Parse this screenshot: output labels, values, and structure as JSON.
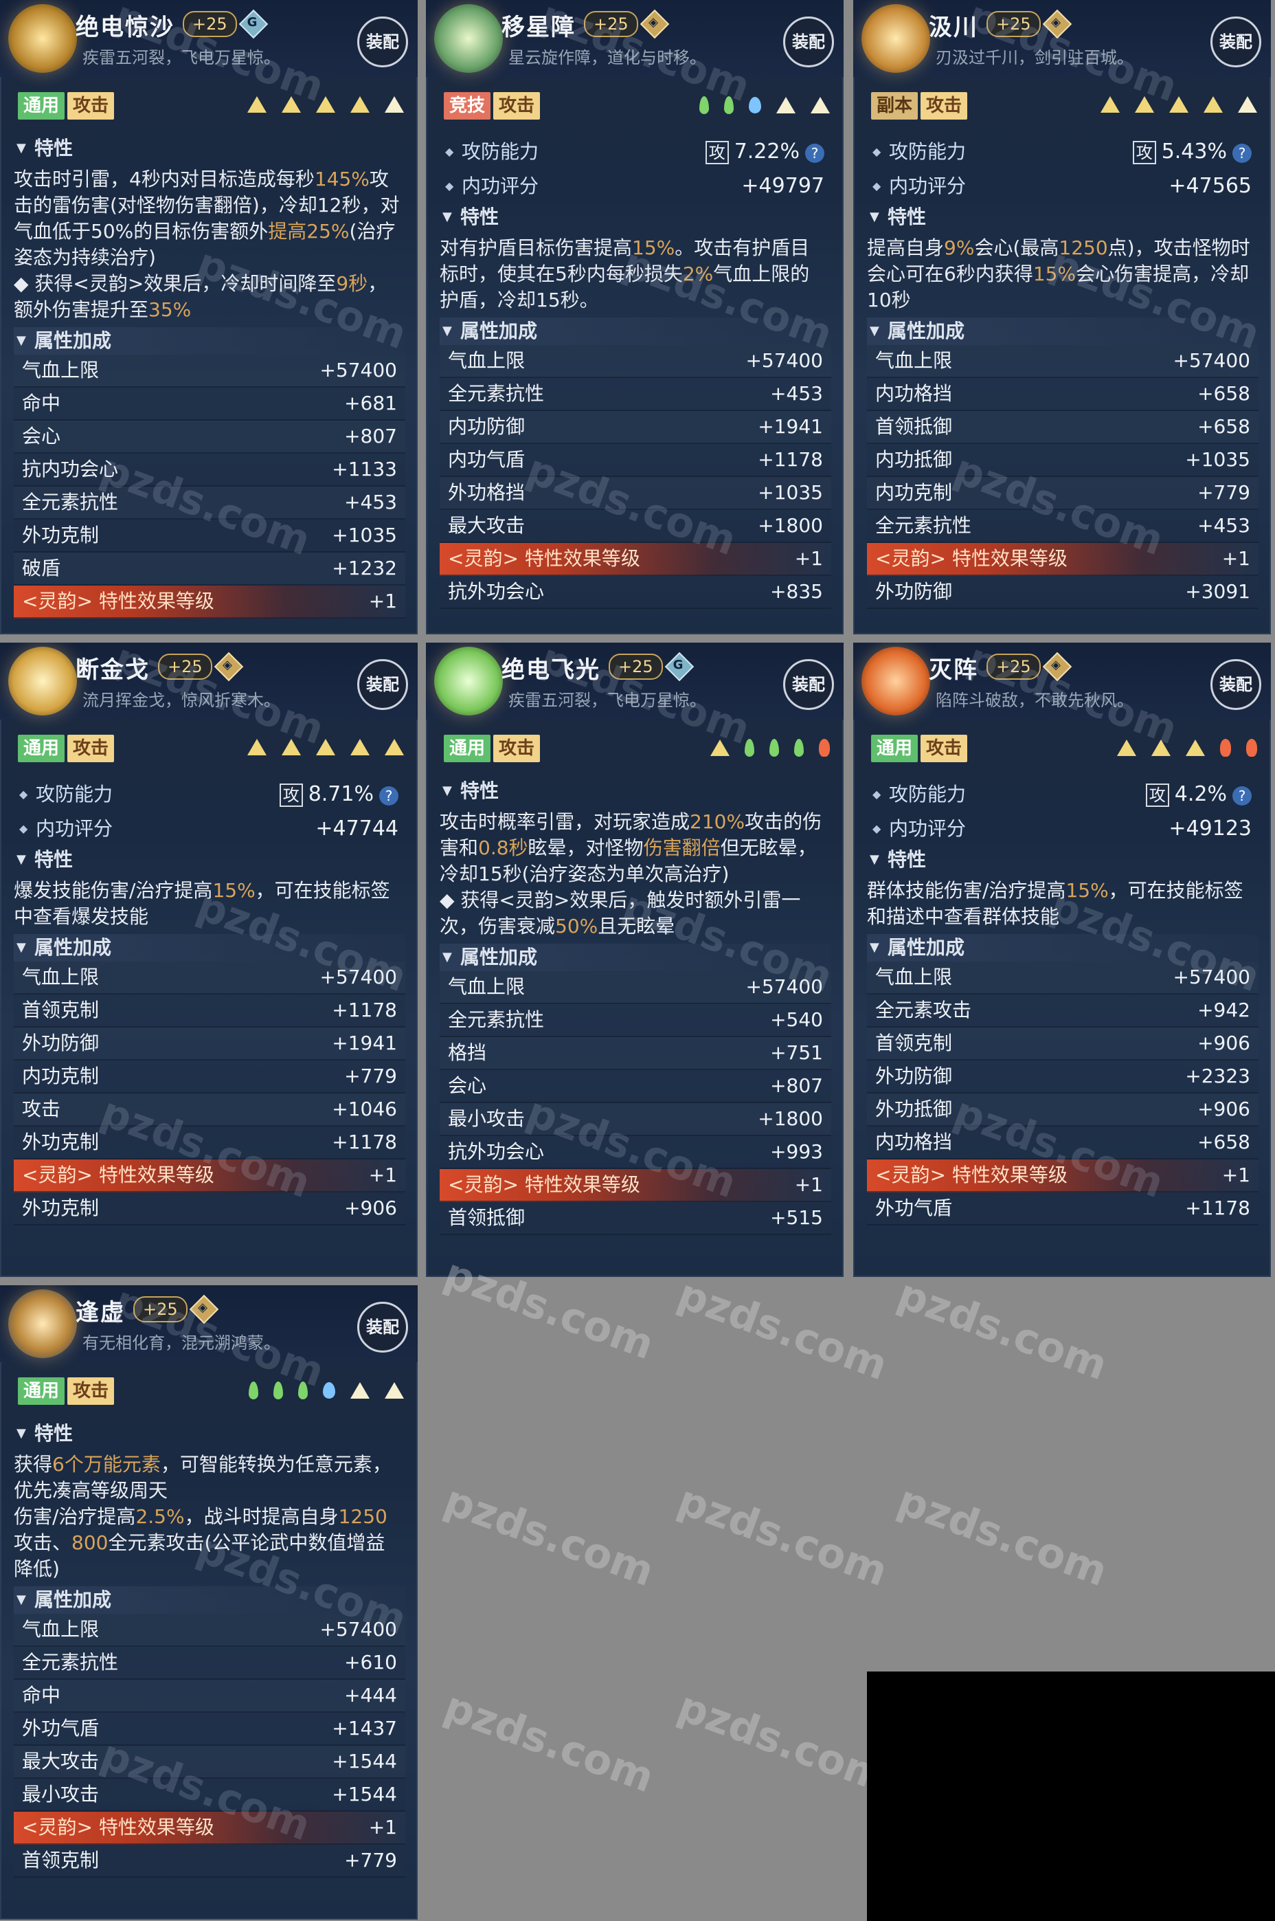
{
  "watermark": "pzds.com",
  "equip_label": "装配",
  "cards": [
    {
      "name": "绝电惊沙",
      "plus": "+25",
      "rarity": "G",
      "desc": "疾雷五河裂，飞电万星惊。",
      "tags": [
        {
          "text": "通用",
          "color": "green"
        },
        {
          "text": "攻击",
          "color": "yellow"
        }
      ],
      "marks": [
        "tri",
        "tri",
        "tri",
        "tri",
        "half"
      ],
      "trait_title": "特性",
      "trait_html_parts": [
        {
          "t": "攻击时引雷，4秒内对目标造成每秒"
        },
        {
          "t": "145%",
          "hl": true
        },
        {
          "t": "攻击的雷伤害(对怪物伤害翻倍)，冷却12秒，对气血低于50%的目标伤害额外"
        },
        {
          "t": "提高25%",
          "hl": true
        },
        {
          "t": "(治疗姿态为持续治疗)"
        },
        {
          "t": "\n◆ 获得<灵韵>效果后，冷却时间降至"
        },
        {
          "t": "9秒",
          "hl": true
        },
        {
          "t": "，额外伤害提升至"
        },
        {
          "t": "35%",
          "hl": true
        }
      ],
      "attr_title": "属性加成",
      "stats": [
        {
          "name": "气血上限",
          "value": "+57400"
        },
        {
          "name": "命中",
          "value": "+681"
        },
        {
          "name": "会心",
          "value": "+807"
        },
        {
          "name": "抗内功会心",
          "value": "+1133"
        },
        {
          "name": "全元素抗性",
          "value": "+453"
        },
        {
          "name": "外功克制",
          "value": "+1035"
        },
        {
          "name": "破盾",
          "value": "+1232"
        },
        {
          "name": "<灵韵> 特性效果等级",
          "value": "+1",
          "special": true
        }
      ]
    },
    {
      "name": "移星障",
      "plus": "+25",
      "rarity": "◈",
      "desc": "星云旋作障，道化与时移。",
      "tags": [
        {
          "text": "竞技",
          "color": "red"
        },
        {
          "text": "攻击",
          "color": "yellow"
        }
      ],
      "marks": [
        "leaf",
        "leaf",
        "drop",
        "half",
        "half"
      ],
      "ability_label": "攻防能力",
      "ability_box": "攻",
      "ability_value": "7.22%",
      "score_label": "内功评分",
      "score_value": "+49797",
      "trait_title": "特性",
      "trait_html_parts": [
        {
          "t": "对有护盾目标伤害提高"
        },
        {
          "t": "15%",
          "hl": true
        },
        {
          "t": "。攻击有护盾目标时，使其在5秒内每秒损失"
        },
        {
          "t": "2%",
          "hl": true
        },
        {
          "t": "气血上限的护盾，冷却15秒。"
        }
      ],
      "attr_title": "属性加成",
      "stats": [
        {
          "name": "气血上限",
          "value": "+57400"
        },
        {
          "name": "全元素抗性",
          "value": "+453"
        },
        {
          "name": "内功防御",
          "value": "+1941"
        },
        {
          "name": "内功气盾",
          "value": "+1178"
        },
        {
          "name": "外功格挡",
          "value": "+1035"
        },
        {
          "name": "最大攻击",
          "value": "+1800"
        },
        {
          "name": "<灵韵> 特性效果等级",
          "value": "+1",
          "special": true
        },
        {
          "name": "抗外功会心",
          "value": "+835"
        }
      ]
    },
    {
      "name": "汲川",
      "plus": "+25",
      "rarity": "◈",
      "desc": "刃汲过千川，剑引驻百城。",
      "tags": [
        {
          "text": "副本",
          "color": "brown"
        },
        {
          "text": "攻击",
          "color": "yellow"
        }
      ],
      "marks": [
        "tri",
        "tri",
        "tri",
        "tri",
        "half"
      ],
      "ability_label": "攻防能力",
      "ability_box": "攻",
      "ability_value": "5.43%",
      "score_label": "内功评分",
      "score_value": "+47565",
      "trait_title": "特性",
      "trait_html_parts": [
        {
          "t": "提高自身"
        },
        {
          "t": "9%",
          "hl": true
        },
        {
          "t": "会心(最高"
        },
        {
          "t": "1250",
          "hl": true
        },
        {
          "t": "点)，攻击怪物时会心可在6秒内获得"
        },
        {
          "t": "15%",
          "hl": true
        },
        {
          "t": "会心伤害提高，冷却10秒"
        }
      ],
      "attr_title": "属性加成",
      "stats": [
        {
          "name": "气血上限",
          "value": "+57400"
        },
        {
          "name": "内功格挡",
          "value": "+658"
        },
        {
          "name": "首领抵御",
          "value": "+658"
        },
        {
          "name": "内功抵御",
          "value": "+1035"
        },
        {
          "name": "内功克制",
          "value": "+779"
        },
        {
          "name": "全元素抗性",
          "value": "+453"
        },
        {
          "name": "<灵韵> 特性效果等级",
          "value": "+1",
          "special": true
        },
        {
          "name": "外功防御",
          "value": "+3091"
        }
      ]
    },
    {
      "name": "断金戈",
      "plus": "+25",
      "rarity": "◈",
      "desc": "流月挥金戈，惊风折寒木。",
      "tags": [
        {
          "text": "通用",
          "color": "green"
        },
        {
          "text": "攻击",
          "color": "yellow"
        }
      ],
      "marks": [
        "tri",
        "tri",
        "tri",
        "tri",
        "tri"
      ],
      "ability_label": "攻防能力",
      "ability_box": "攻",
      "ability_value": "8.71%",
      "score_label": "内功评分",
      "score_value": "+47744",
      "trait_title": "特性",
      "trait_html_parts": [
        {
          "t": "爆发技能伤害/治疗提高"
        },
        {
          "t": "15%",
          "hl": true
        },
        {
          "t": "，可在技能标签中查看爆发技能"
        }
      ],
      "attr_title": "属性加成",
      "stats": [
        {
          "name": "气血上限",
          "value": "+57400"
        },
        {
          "name": "首领克制",
          "value": "+1178"
        },
        {
          "name": "外功防御",
          "value": "+1941"
        },
        {
          "name": "内功克制",
          "value": "+779"
        },
        {
          "name": "攻击",
          "value": "+1046"
        },
        {
          "name": "外功克制",
          "value": "+1178"
        },
        {
          "name": "<灵韵> 特性效果等级",
          "value": "+1",
          "special": true
        },
        {
          "name": "外功克制",
          "value": "+906"
        }
      ]
    },
    {
      "name": "绝电飞光",
      "plus": "+25",
      "rarity": "G",
      "desc": "疾雷五河裂，飞电万星惊。",
      "tags": [
        {
          "text": "通用",
          "color": "green"
        },
        {
          "text": "攻击",
          "color": "yellow"
        }
      ],
      "marks": [
        "tri",
        "leaf",
        "leaf",
        "leaf",
        "flame"
      ],
      "trait_title": "特性",
      "trait_html_parts": [
        {
          "t": "攻击时概率引雷，对玩家造成"
        },
        {
          "t": "210%",
          "hl": true
        },
        {
          "t": "攻击的伤害和"
        },
        {
          "t": "0.8秒",
          "hl": true
        },
        {
          "t": "眩晕，对怪物"
        },
        {
          "t": "伤害翻倍",
          "hl": true
        },
        {
          "t": "但无眩晕，冷却15秒(治疗姿态为单次高治疗)"
        },
        {
          "t": "\n◆ 获得<灵韵>效果后，触发时额外引雷一次，伤害衰减"
        },
        {
          "t": "50%",
          "hl": true
        },
        {
          "t": "且无眩晕"
        }
      ],
      "attr_title": "属性加成",
      "stats": [
        {
          "name": "气血上限",
          "value": "+57400"
        },
        {
          "name": "全元素抗性",
          "value": "+540"
        },
        {
          "name": "格挡",
          "value": "+751"
        },
        {
          "name": "会心",
          "value": "+807"
        },
        {
          "name": "最小攻击",
          "value": "+1800"
        },
        {
          "name": "抗外功会心",
          "value": "+993"
        },
        {
          "name": "<灵韵> 特性效果等级",
          "value": "+1",
          "special": true
        },
        {
          "name": "首领抵御",
          "value": "+515"
        }
      ]
    },
    {
      "name": "灭阵",
      "plus": "+25",
      "rarity": "◈",
      "desc": "陷阵斗破敌，不敢先秋风。",
      "tags": [
        {
          "text": "通用",
          "color": "green"
        },
        {
          "text": "攻击",
          "color": "yellow"
        }
      ],
      "marks": [
        "tri",
        "tri",
        "tri",
        "flame",
        "flame"
      ],
      "ability_label": "攻防能力",
      "ability_box": "攻",
      "ability_value": "4.2%",
      "score_label": "内功评分",
      "score_value": "+49123",
      "trait_title": "特性",
      "trait_html_parts": [
        {
          "t": "群体技能伤害/治疗提高"
        },
        {
          "t": "15%",
          "hl": true
        },
        {
          "t": "，可在技能标签和描述中查看群体技能"
        }
      ],
      "attr_title": "属性加成",
      "stats": [
        {
          "name": "气血上限",
          "value": "+57400"
        },
        {
          "name": "全元素攻击",
          "value": "+942"
        },
        {
          "name": "首领克制",
          "value": "+906"
        },
        {
          "name": "外功防御",
          "value": "+2323"
        },
        {
          "name": "外功抵御",
          "value": "+906"
        },
        {
          "name": "内功格挡",
          "value": "+658"
        },
        {
          "name": "<灵韵> 特性效果等级",
          "value": "+1",
          "special": true
        },
        {
          "name": "外功气盾",
          "value": "+1178"
        }
      ]
    },
    {
      "name": "逢虚",
      "plus": "+25",
      "rarity": "◈",
      "desc": "有无相化育，混元溯鸿蒙。",
      "tags": [
        {
          "text": "通用",
          "color": "green"
        },
        {
          "text": "攻击",
          "color": "yellow"
        }
      ],
      "marks": [
        "leaf",
        "leaf",
        "leaf",
        "drop",
        "half",
        "half"
      ],
      "trait_title": "特性",
      "trait_html_parts": [
        {
          "t": "获得"
        },
        {
          "t": "6个万能元素",
          "hl": true
        },
        {
          "t": "，可智能转换为任意元素，优先凑高等级周天\n伤害/治疗提高"
        },
        {
          "t": "2.5%",
          "hl": true
        },
        {
          "t": "，战斗时提高自身"
        },
        {
          "t": "1250",
          "hl": true
        },
        {
          "t": "攻击、"
        },
        {
          "t": "800",
          "hl": true
        },
        {
          "t": "全元素攻击(公平论武中数值增益降低)"
        }
      ],
      "attr_title": "属性加成",
      "stats": [
        {
          "name": "气血上限",
          "value": "+57400"
        },
        {
          "name": "全元素抗性",
          "value": "+610"
        },
        {
          "name": "命中",
          "value": "+444"
        },
        {
          "name": "外功气盾",
          "value": "+1437"
        },
        {
          "name": "最大攻击",
          "value": "+1544"
        },
        {
          "name": "最小攻击",
          "value": "+1544"
        },
        {
          "name": "<灵韵> 特性效果等级",
          "value": "+1",
          "special": true
        },
        {
          "name": "首领克制",
          "value": "+779"
        }
      ]
    }
  ]
}
